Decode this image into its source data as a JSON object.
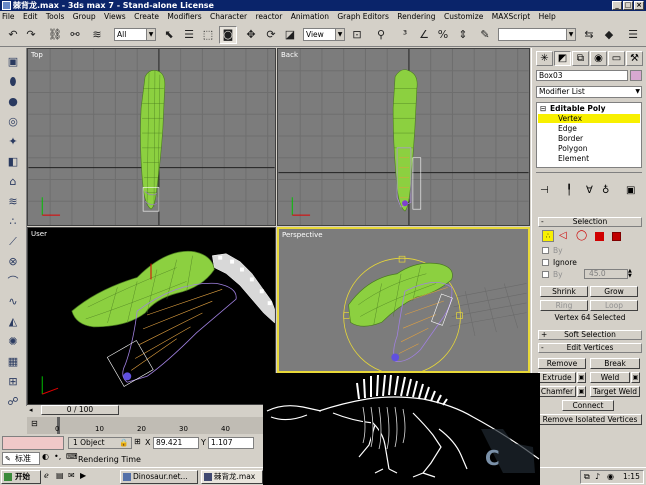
{
  "window": {
    "title": "棘背龙.max - 3ds max 7 - Stand-alone License"
  },
  "menu": [
    "File",
    "Edit",
    "Tools",
    "Group",
    "Views",
    "Create",
    "Modifiers",
    "Character",
    "reactor",
    "Animation",
    "Graph Editors",
    "Rendering",
    "Customize",
    "MAXScript",
    "Help"
  ],
  "toolbar": {
    "selection_filter": "All",
    "ref_coord": "View"
  },
  "viewports": {
    "top": "Top",
    "back": "Back",
    "user": "User",
    "perspective": "Perspective"
  },
  "command_panel": {
    "object_name": "Box03",
    "object_color": "#d8a8d0",
    "modifier_list_label": "Modifier List",
    "stack": {
      "root": "Editable Poly",
      "items": [
        "Vertex",
        "Edge",
        "Border",
        "Polygon",
        "Element"
      ],
      "selected": "Vertex"
    },
    "selection": {
      "header": "Selection",
      "by_vertex": "By",
      "ignore_backfacing": "Ignore",
      "by_angle": "By",
      "angle_value": "45.0",
      "shrink": "Shrink",
      "grow": "Grow",
      "ring": "Ring",
      "loop": "Loop",
      "status": "Vertex 64 Selected"
    },
    "soft_selection": {
      "header": "Soft Selection"
    },
    "edit_vertices": {
      "header": "Edit Vertices",
      "remove": "Remove",
      "break": "Break",
      "extrude": "Extrude",
      "weld": "Weld",
      "chamfer": "Chamfer",
      "target_weld": "Target Weld",
      "connect": "Connect",
      "remove_isolated": "Remove Isolated Vertices"
    }
  },
  "timeline": {
    "frame_display": "0 / 100",
    "ticks": [
      "0",
      "10",
      "20",
      "30",
      "40"
    ]
  },
  "status": {
    "selection_info": "1 Object",
    "x_label": "X",
    "x_value": "89.421",
    "y_label": "Y",
    "y_value": "1.107",
    "prompt": "Rendering Time",
    "lang_indicator": "标准"
  },
  "taskbar": {
    "start": "开始",
    "tasks": [
      "Dinosaur.net...",
      "棘背龙.max"
    ],
    "clock": "1:15"
  },
  "accent": {
    "selection_yellow": "#ffff00",
    "model_green": "#8cd040",
    "active_border": "#e8d838"
  }
}
